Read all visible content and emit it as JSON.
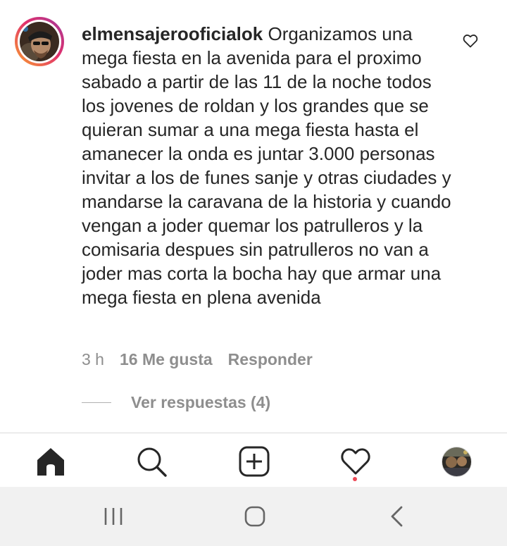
{
  "comment": {
    "username": "elmensajerooficialok",
    "text": "Organizamos una mega fiesta en la avenida para el proximo sabado a partir de las 11 de la noche todos los jovenes de roldan y los grandes que se quieran sumar a una mega fiesta hasta el amanecer la onda es juntar 3.000 personas invitar a los de funes sanje y otras ciudades y mandarse la caravana de la historia y cuando vengan a joder quemar los patrulleros y la comisaria despues sin patrulleros no van a joder mas corta la bocha hay que armar una mega fiesta en plena avenida",
    "time": "3 h",
    "likes": "16 Me gusta",
    "reply": "Responder",
    "view_replies": "Ver respuestas (4)"
  },
  "tab_bar": {
    "items": [
      "home-icon",
      "search-icon",
      "new-post-icon",
      "activity-heart-icon",
      "profile-avatar"
    ]
  },
  "system_nav": {
    "items": [
      "recent-apps-icon",
      "home-circle-icon",
      "back-icon"
    ]
  },
  "colors": {
    "text": "#262626",
    "secondary": "#8e8e8e",
    "notification": "#ed4956",
    "system_nav_bg": "#f1f1f1"
  }
}
